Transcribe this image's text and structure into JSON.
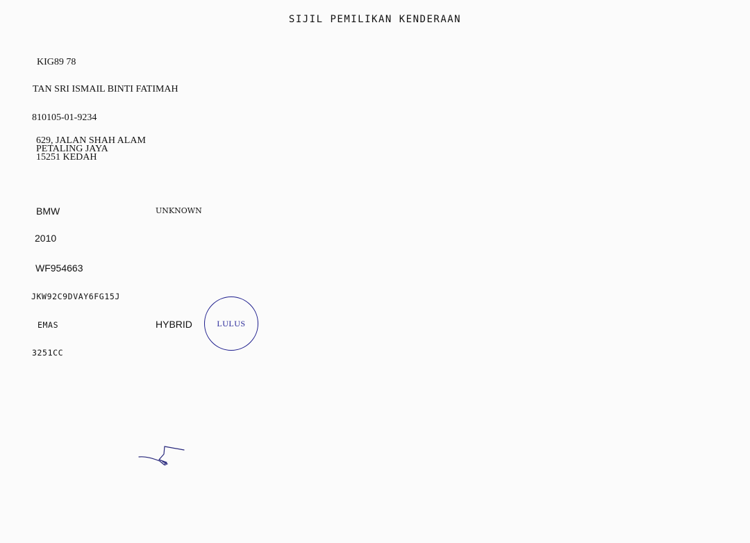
{
  "document": {
    "title": "SIJIL PEMILIKAN KENDERAAN"
  },
  "registration_number": "KIG89 78",
  "owner": {
    "name": "TAN SRI ISMAIL BINTI FATIMAH",
    "ic_number": "810105-01-9234",
    "address_lines": [
      "629, JALAN SHAH ALAM",
      "PETALING JAYA",
      "15251 KEDAH"
    ]
  },
  "vehicle": {
    "make": "BMW",
    "model": "UNKNOWN",
    "year": "2010",
    "engine_number": "WF954663",
    "chassis_number": "JKW92C9DVAY6FG15J",
    "color": "EMAS",
    "fuel_type": "HYBRID",
    "engine_capacity": "3251CC"
  },
  "stamp": {
    "text": "LULUS",
    "color": "#1b1b8c"
  }
}
